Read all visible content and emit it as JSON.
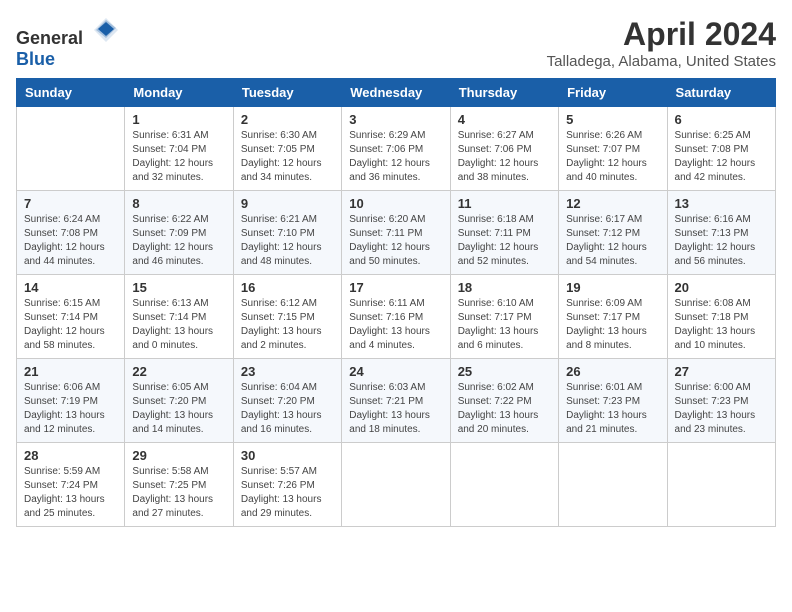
{
  "header": {
    "logo_general": "General",
    "logo_blue": "Blue",
    "month_title": "April 2024",
    "location": "Talladega, Alabama, United States"
  },
  "days_of_week": [
    "Sunday",
    "Monday",
    "Tuesday",
    "Wednesday",
    "Thursday",
    "Friday",
    "Saturday"
  ],
  "weeks": [
    [
      {
        "day": "",
        "sunrise": "",
        "sunset": "",
        "daylight": ""
      },
      {
        "day": "1",
        "sunrise": "Sunrise: 6:31 AM",
        "sunset": "Sunset: 7:04 PM",
        "daylight": "Daylight: 12 hours and 32 minutes."
      },
      {
        "day": "2",
        "sunrise": "Sunrise: 6:30 AM",
        "sunset": "Sunset: 7:05 PM",
        "daylight": "Daylight: 12 hours and 34 minutes."
      },
      {
        "day": "3",
        "sunrise": "Sunrise: 6:29 AM",
        "sunset": "Sunset: 7:06 PM",
        "daylight": "Daylight: 12 hours and 36 minutes."
      },
      {
        "day": "4",
        "sunrise": "Sunrise: 6:27 AM",
        "sunset": "Sunset: 7:06 PM",
        "daylight": "Daylight: 12 hours and 38 minutes."
      },
      {
        "day": "5",
        "sunrise": "Sunrise: 6:26 AM",
        "sunset": "Sunset: 7:07 PM",
        "daylight": "Daylight: 12 hours and 40 minutes."
      },
      {
        "day": "6",
        "sunrise": "Sunrise: 6:25 AM",
        "sunset": "Sunset: 7:08 PM",
        "daylight": "Daylight: 12 hours and 42 minutes."
      }
    ],
    [
      {
        "day": "7",
        "sunrise": "Sunrise: 6:24 AM",
        "sunset": "Sunset: 7:08 PM",
        "daylight": "Daylight: 12 hours and 44 minutes."
      },
      {
        "day": "8",
        "sunrise": "Sunrise: 6:22 AM",
        "sunset": "Sunset: 7:09 PM",
        "daylight": "Daylight: 12 hours and 46 minutes."
      },
      {
        "day": "9",
        "sunrise": "Sunrise: 6:21 AM",
        "sunset": "Sunset: 7:10 PM",
        "daylight": "Daylight: 12 hours and 48 minutes."
      },
      {
        "day": "10",
        "sunrise": "Sunrise: 6:20 AM",
        "sunset": "Sunset: 7:11 PM",
        "daylight": "Daylight: 12 hours and 50 minutes."
      },
      {
        "day": "11",
        "sunrise": "Sunrise: 6:18 AM",
        "sunset": "Sunset: 7:11 PM",
        "daylight": "Daylight: 12 hours and 52 minutes."
      },
      {
        "day": "12",
        "sunrise": "Sunrise: 6:17 AM",
        "sunset": "Sunset: 7:12 PM",
        "daylight": "Daylight: 12 hours and 54 minutes."
      },
      {
        "day": "13",
        "sunrise": "Sunrise: 6:16 AM",
        "sunset": "Sunset: 7:13 PM",
        "daylight": "Daylight: 12 hours and 56 minutes."
      }
    ],
    [
      {
        "day": "14",
        "sunrise": "Sunrise: 6:15 AM",
        "sunset": "Sunset: 7:14 PM",
        "daylight": "Daylight: 12 hours and 58 minutes."
      },
      {
        "day": "15",
        "sunrise": "Sunrise: 6:13 AM",
        "sunset": "Sunset: 7:14 PM",
        "daylight": "Daylight: 13 hours and 0 minutes."
      },
      {
        "day": "16",
        "sunrise": "Sunrise: 6:12 AM",
        "sunset": "Sunset: 7:15 PM",
        "daylight": "Daylight: 13 hours and 2 minutes."
      },
      {
        "day": "17",
        "sunrise": "Sunrise: 6:11 AM",
        "sunset": "Sunset: 7:16 PM",
        "daylight": "Daylight: 13 hours and 4 minutes."
      },
      {
        "day": "18",
        "sunrise": "Sunrise: 6:10 AM",
        "sunset": "Sunset: 7:17 PM",
        "daylight": "Daylight: 13 hours and 6 minutes."
      },
      {
        "day": "19",
        "sunrise": "Sunrise: 6:09 AM",
        "sunset": "Sunset: 7:17 PM",
        "daylight": "Daylight: 13 hours and 8 minutes."
      },
      {
        "day": "20",
        "sunrise": "Sunrise: 6:08 AM",
        "sunset": "Sunset: 7:18 PM",
        "daylight": "Daylight: 13 hours and 10 minutes."
      }
    ],
    [
      {
        "day": "21",
        "sunrise": "Sunrise: 6:06 AM",
        "sunset": "Sunset: 7:19 PM",
        "daylight": "Daylight: 13 hours and 12 minutes."
      },
      {
        "day": "22",
        "sunrise": "Sunrise: 6:05 AM",
        "sunset": "Sunset: 7:20 PM",
        "daylight": "Daylight: 13 hours and 14 minutes."
      },
      {
        "day": "23",
        "sunrise": "Sunrise: 6:04 AM",
        "sunset": "Sunset: 7:20 PM",
        "daylight": "Daylight: 13 hours and 16 minutes."
      },
      {
        "day": "24",
        "sunrise": "Sunrise: 6:03 AM",
        "sunset": "Sunset: 7:21 PM",
        "daylight": "Daylight: 13 hours and 18 minutes."
      },
      {
        "day": "25",
        "sunrise": "Sunrise: 6:02 AM",
        "sunset": "Sunset: 7:22 PM",
        "daylight": "Daylight: 13 hours and 20 minutes."
      },
      {
        "day": "26",
        "sunrise": "Sunrise: 6:01 AM",
        "sunset": "Sunset: 7:23 PM",
        "daylight": "Daylight: 13 hours and 21 minutes."
      },
      {
        "day": "27",
        "sunrise": "Sunrise: 6:00 AM",
        "sunset": "Sunset: 7:23 PM",
        "daylight": "Daylight: 13 hours and 23 minutes."
      }
    ],
    [
      {
        "day": "28",
        "sunrise": "Sunrise: 5:59 AM",
        "sunset": "Sunset: 7:24 PM",
        "daylight": "Daylight: 13 hours and 25 minutes."
      },
      {
        "day": "29",
        "sunrise": "Sunrise: 5:58 AM",
        "sunset": "Sunset: 7:25 PM",
        "daylight": "Daylight: 13 hours and 27 minutes."
      },
      {
        "day": "30",
        "sunrise": "Sunrise: 5:57 AM",
        "sunset": "Sunset: 7:26 PM",
        "daylight": "Daylight: 13 hours and 29 minutes."
      },
      {
        "day": "",
        "sunrise": "",
        "sunset": "",
        "daylight": ""
      },
      {
        "day": "",
        "sunrise": "",
        "sunset": "",
        "daylight": ""
      },
      {
        "day": "",
        "sunrise": "",
        "sunset": "",
        "daylight": ""
      },
      {
        "day": "",
        "sunrise": "",
        "sunset": "",
        "daylight": ""
      }
    ]
  ]
}
